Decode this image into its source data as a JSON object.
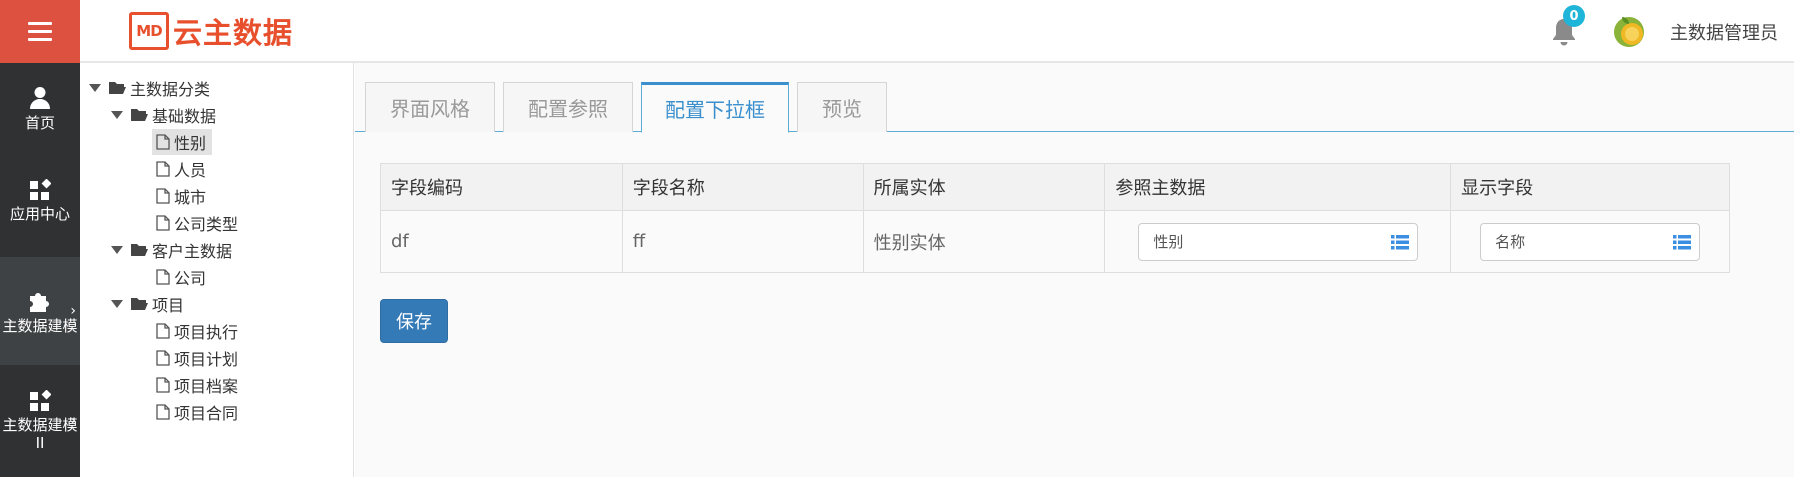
{
  "header": {
    "logo_mark": "MD",
    "logo_text": "云主数据",
    "notification_count": "0",
    "user_name": "主数据管理员"
  },
  "leftnav": {
    "items": [
      {
        "label": "首页",
        "icon": "user-icon",
        "active": false
      },
      {
        "label": "应用中心",
        "icon": "apps-icon",
        "active": false
      },
      {
        "label": "主数据建模",
        "icon": "puzzle-icon",
        "active": true,
        "has_submenu": true
      },
      {
        "label": "主数据建模II",
        "icon": "apps-icon",
        "active": false,
        "has_submenu": true
      }
    ]
  },
  "tree": {
    "root": "主数据分类",
    "nodes": [
      {
        "label": "基础数据",
        "type": "folder",
        "level": 1
      },
      {
        "label": "性别",
        "type": "file",
        "level": 2,
        "selected": true
      },
      {
        "label": "人员",
        "type": "file",
        "level": 2
      },
      {
        "label": "城市",
        "type": "file",
        "level": 2
      },
      {
        "label": "公司类型",
        "type": "file",
        "level": 2
      },
      {
        "label": "客户主数据",
        "type": "folder",
        "level": 1
      },
      {
        "label": "公司",
        "type": "file",
        "level": 2
      },
      {
        "label": "项目",
        "type": "folder",
        "level": 1
      },
      {
        "label": "项目执行",
        "type": "file",
        "level": 2
      },
      {
        "label": "项目计划",
        "type": "file",
        "level": 2
      },
      {
        "label": "项目档案",
        "type": "file",
        "level": 2
      },
      {
        "label": "项目合同",
        "type": "file",
        "level": 2
      }
    ]
  },
  "tabs": [
    {
      "label": "界面风格",
      "active": false
    },
    {
      "label": "配置参照",
      "active": false
    },
    {
      "label": "配置下拉框",
      "active": true
    },
    {
      "label": "预览",
      "active": false
    }
  ],
  "table": {
    "headers": [
      "字段编码",
      "字段名称",
      "所属实体",
      "参照主数据",
      "显示字段"
    ],
    "rows": [
      {
        "code": "df",
        "name": "ff",
        "entity": "性别实体",
        "ref_master": "性别",
        "display_field": "名称"
      }
    ]
  },
  "save_label": "保存",
  "colors": {
    "accent": "#337ab7",
    "menu_toggle": "#dd5140",
    "nav_bg": "#2f3133",
    "tab_active": "#3a8fcc",
    "logo": "#e8502d"
  }
}
